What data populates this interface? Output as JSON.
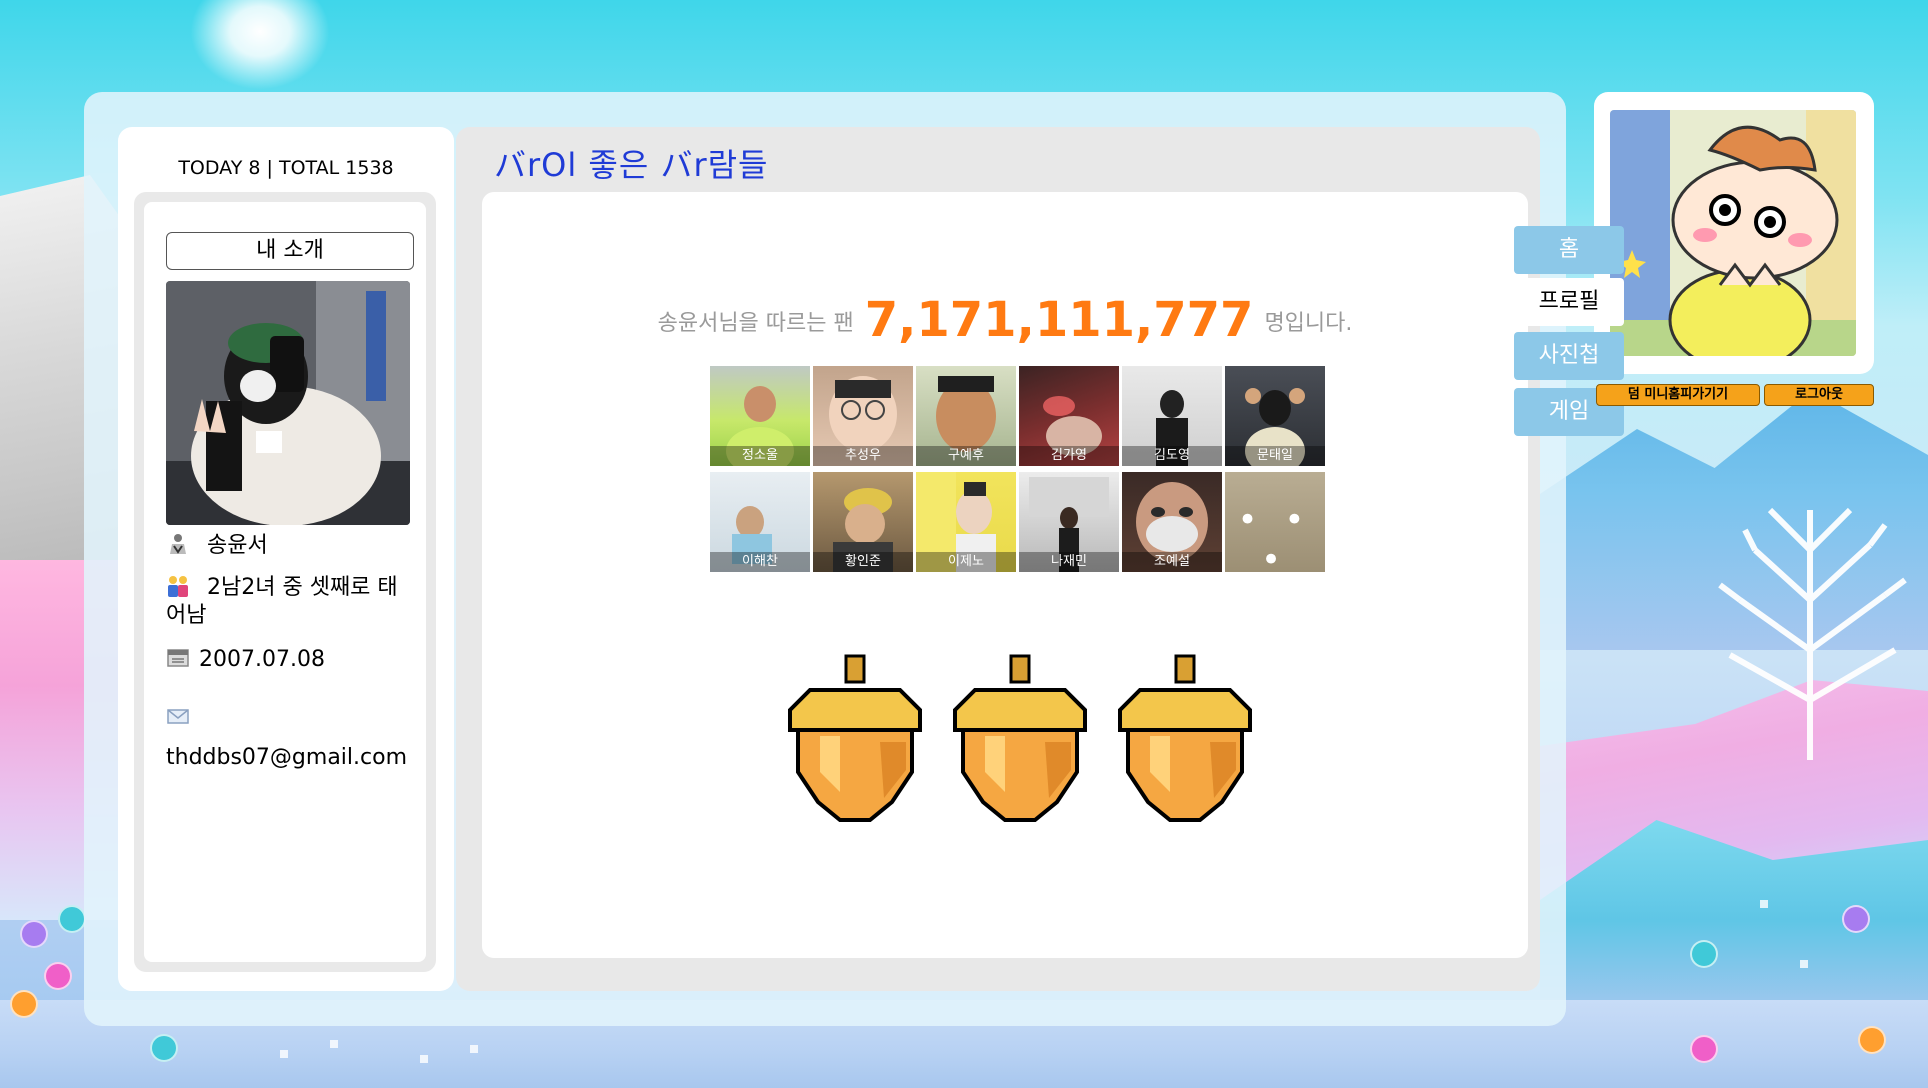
{
  "counter": {
    "today_label": "TODAY",
    "today_value": "8",
    "separator": "|",
    "total_label": "TOTAL",
    "total_value": "1538"
  },
  "sidebar": {
    "intro_button": "내 소개",
    "name": "송윤서",
    "family": "2남2녀 중 셋째로 태어남",
    "birthday": "2007.07.08",
    "email": "thddbs07@gmail.com"
  },
  "main": {
    "section_title": "バrOl 좋은 バr람들",
    "fan_prefix": "송윤서님을 따르는 팬",
    "fan_count": "7,171,111,777",
    "fan_suffix": "명입니다.",
    "friends": [
      {
        "name": "정소울"
      },
      {
        "name": "추성우"
      },
      {
        "name": "구예후"
      },
      {
        "name": "김가영"
      },
      {
        "name": "김도영"
      },
      {
        "name": "문태일"
      },
      {
        "name": "이해찬"
      },
      {
        "name": "황인준"
      },
      {
        "name": "이제노"
      },
      {
        "name": "나재민"
      },
      {
        "name": "조예설"
      }
    ],
    "more_label": "• • •"
  },
  "nav": {
    "tabs": [
      "홈",
      "프로필",
      "사진첩",
      "게임"
    ],
    "active_tab": "프로필",
    "visit_button": "덤 미니홈피가기기",
    "logout_button": "로그아웃"
  },
  "colors": {
    "title_blue": "#1f3bd6",
    "fan_orange": "#ff7a12",
    "tab_blue": "#8cc8e8",
    "button_orange": "#f5a21a"
  },
  "icons": {
    "name": "person-icon",
    "family": "family-icon",
    "birthday": "calendar-icon",
    "email": "envelope-icon"
  }
}
